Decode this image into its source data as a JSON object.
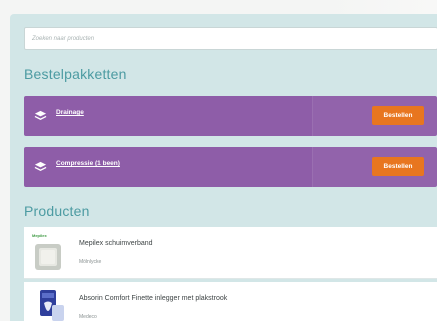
{
  "search": {
    "placeholder": "Zoeken naar producten"
  },
  "packages": {
    "title": "Bestelpakketten",
    "items": [
      {
        "label": "Drainage",
        "button": "Bestellen"
      },
      {
        "label": "Compressie (1 been)",
        "button": "Bestellen"
      }
    ]
  },
  "products": {
    "title": "Producten",
    "items": [
      {
        "name": "Mepilex schuimverband",
        "brand": "Mölnlycke",
        "logo_text": "Mepilex"
      },
      {
        "name": "Absorin Comfort Finette inlegger met plakstrook",
        "brand": "Medeco"
      }
    ]
  },
  "colors": {
    "panel": "#d2e6e7",
    "section_title": "#4c9ba2",
    "package_bg": "#8e5da8",
    "order_button": "#e8761f"
  },
  "icons": {
    "package": "layers-icon"
  }
}
